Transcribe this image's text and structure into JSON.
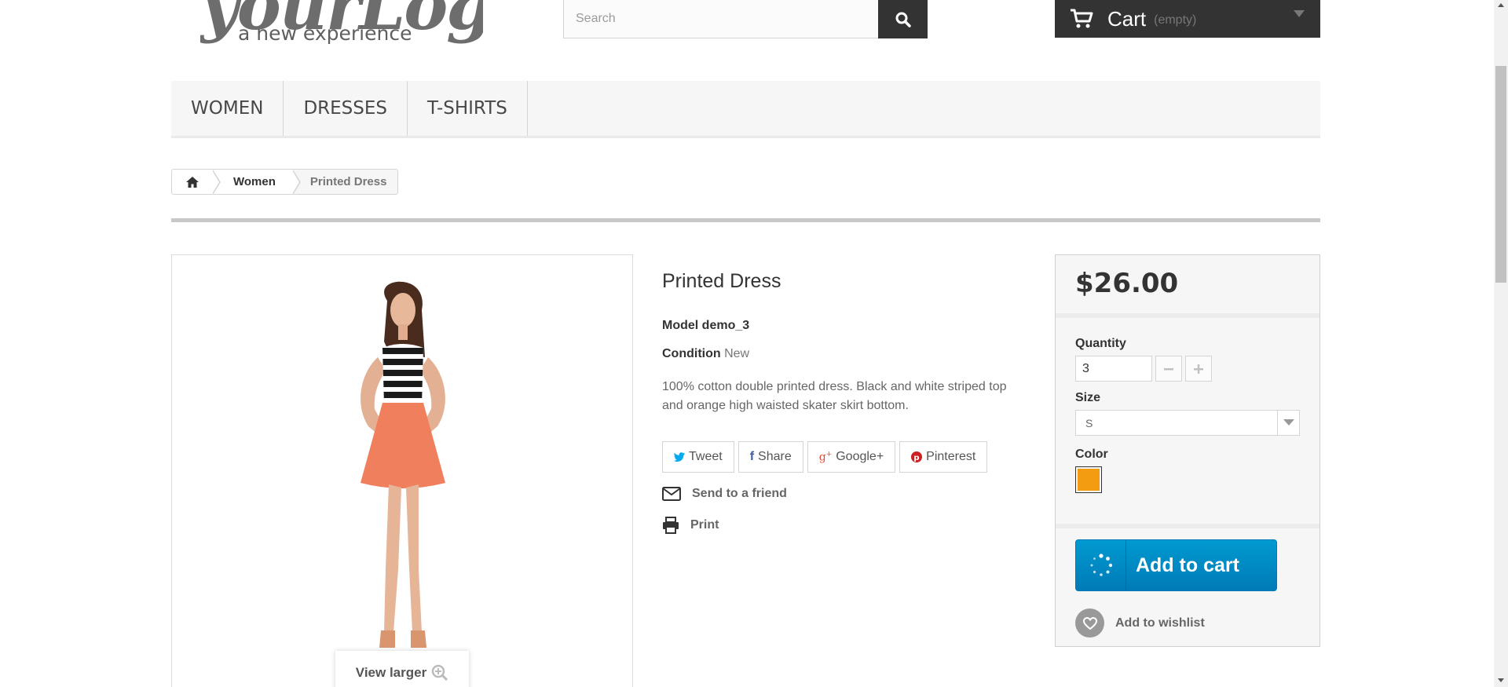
{
  "header": {
    "logo": {
      "wordmark": "yourLogo",
      "tagline": "a new experience"
    },
    "search": {
      "placeholder": "Search"
    },
    "cart": {
      "label": "Cart",
      "status": "(empty)"
    }
  },
  "menu": {
    "items": [
      {
        "label": "WOMEN"
      },
      {
        "label": "DRESSES"
      },
      {
        "label": "T-SHIRTS"
      }
    ]
  },
  "breadcrumb": {
    "items": [
      {
        "label": "Women"
      },
      {
        "label": "Printed Dress"
      }
    ]
  },
  "image": {
    "view_larger": "View larger"
  },
  "product": {
    "title": "Printed Dress",
    "model_label": "Model",
    "model_value": "demo_3",
    "condition_label": "Condition",
    "condition_value": "New",
    "description": "100% cotton double printed dress. Black and white striped top and orange high waisted skater skirt bottom."
  },
  "social": {
    "tweet": "Tweet",
    "share": "Share",
    "google": "Google+",
    "pinterest": "Pinterest"
  },
  "actions": {
    "send_friend": "Send to a friend",
    "print": "Print"
  },
  "buy_box": {
    "price": "$26.00",
    "quantity_label": "Quantity",
    "quantity_value": "3",
    "size_label": "Size",
    "size_value": "S",
    "color_label": "Color",
    "color_swatch": "#f39c11",
    "add_to_cart": "Add to cart",
    "wishlist": "Add to wishlist"
  },
  "colors": {
    "dark": "#333333",
    "accent_blue": "#009ad0",
    "panel_bg": "#f6f6f6"
  }
}
